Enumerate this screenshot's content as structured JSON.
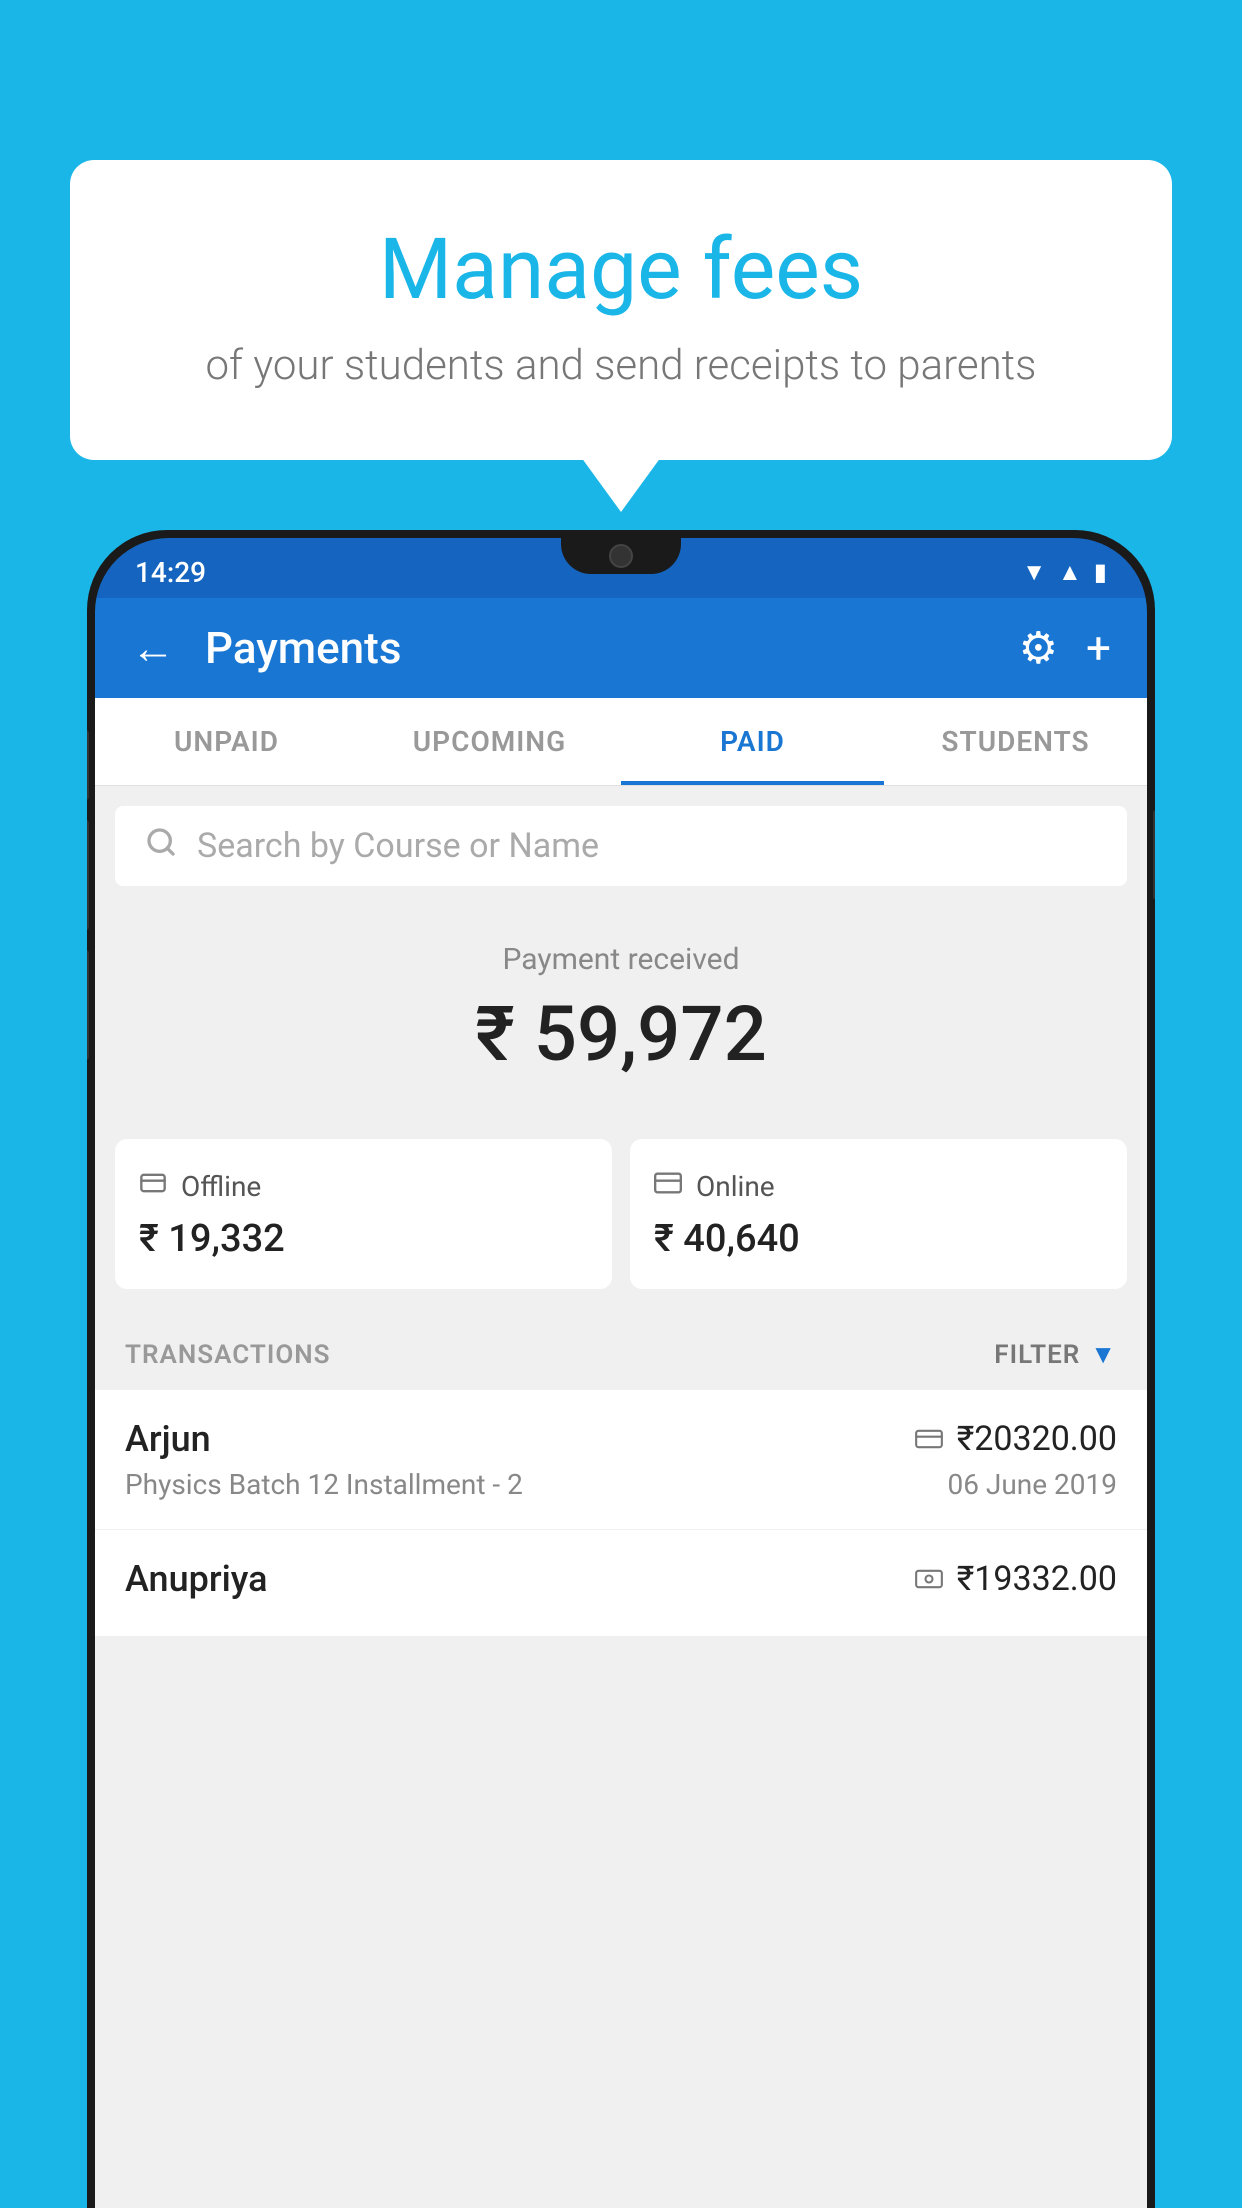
{
  "background_color": "#1ab6e8",
  "bubble": {
    "title": "Manage fees",
    "subtitle": "of your students and send receipts to parents"
  },
  "status_bar": {
    "time": "14:29",
    "wifi_icon": "▼",
    "signal_icon": "▲",
    "battery_icon": "▮"
  },
  "header": {
    "title": "Payments",
    "back_label": "←",
    "gear_label": "⚙",
    "plus_label": "+"
  },
  "tabs": [
    {
      "label": "UNPAID",
      "active": false
    },
    {
      "label": "UPCOMING",
      "active": false
    },
    {
      "label": "PAID",
      "active": true
    },
    {
      "label": "STUDENTS",
      "active": false
    }
  ],
  "search": {
    "placeholder": "Search by Course or Name"
  },
  "payment_summary": {
    "received_label": "Payment received",
    "amount": "₹ 59,972",
    "offline": {
      "label": "Offline",
      "amount": "₹ 19,332"
    },
    "online": {
      "label": "Online",
      "amount": "₹ 40,640"
    }
  },
  "transactions_section": {
    "label": "TRANSACTIONS",
    "filter_label": "FILTER"
  },
  "transactions": [
    {
      "name": "Arjun",
      "course": "Physics Batch 12 Installment - 2",
      "amount": "₹20320.00",
      "date": "06 June 2019",
      "mode_icon": "💳"
    },
    {
      "name": "Anupriya",
      "course": "",
      "amount": "₹19332.00",
      "date": "",
      "mode_icon": "🪙"
    }
  ]
}
